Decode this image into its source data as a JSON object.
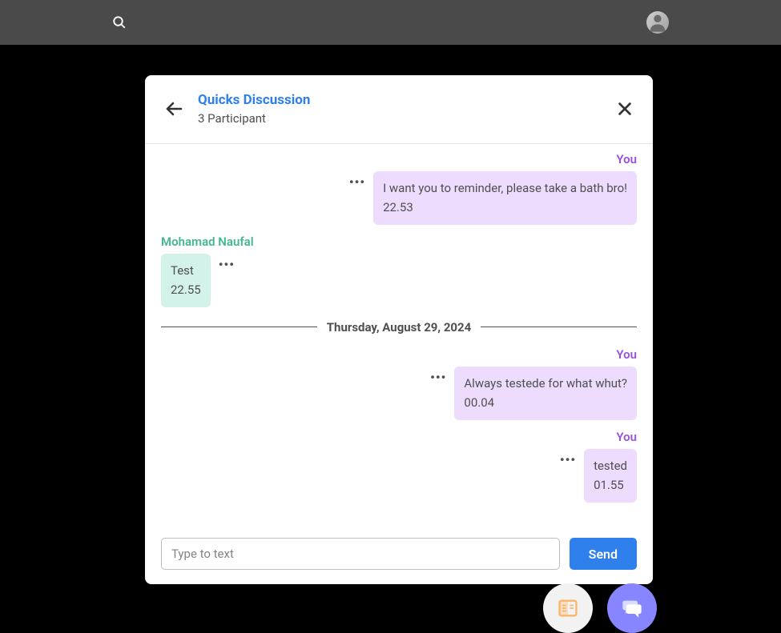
{
  "header": {
    "title": "Quicks Discussion",
    "subtitle": "3 Participant"
  },
  "labels": {
    "you": "You"
  },
  "messages": {
    "m1": {
      "sender_label": "You",
      "text": "I want you to reminder, please take a bath bro!",
      "time": "22.53"
    },
    "m2": {
      "sender_label": "Mohamad Naufal",
      "text": "Test",
      "time": "22.55"
    },
    "m3": {
      "sender_label": "You",
      "text": "Always testede for what whut?",
      "time": "00.04"
    },
    "m4": {
      "sender_label": "You",
      "text": "tested",
      "time": "01.55"
    }
  },
  "date_divider": "Thursday, August 29, 2024",
  "input": {
    "placeholder": "Type to text",
    "send_label": "Send"
  },
  "icons": {
    "search": "search-icon",
    "avatar": "avatar",
    "back": "arrow-left-icon",
    "close": "close-icon",
    "more": "more-horizontal-icon",
    "task": "reader-icon",
    "chat": "chat-icon"
  },
  "colors": {
    "primary_blue": "#2f80ed",
    "purple_sender": "#9b51e0",
    "green_sender": "#43b78d",
    "bubble_you": "#eedcff",
    "bubble_other": "#d2f2ea",
    "fab_primary": "#8785ff"
  }
}
